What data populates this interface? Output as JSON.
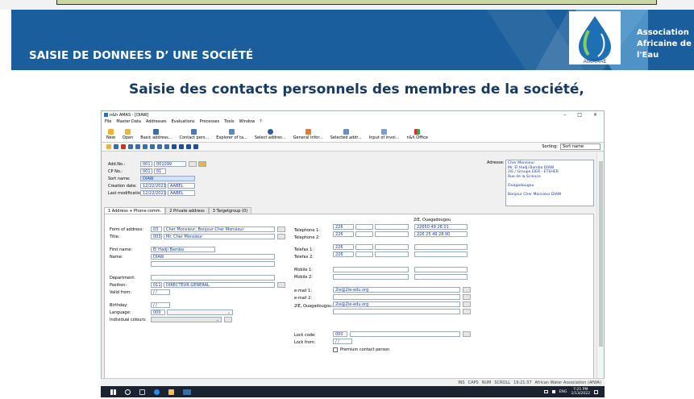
{
  "banner": {
    "title": "SAISIE DE DONNEES D’ UNE SOCIÉTÉ",
    "assoc_line1": "Association",
    "assoc_line2": "Africaine de l'Eau",
    "logo_text": "AIWA/AAE",
    "accent": "#1b5e9d"
  },
  "slide_heading": "Saisie des contacts personnels des membres de la société,",
  "app": {
    "window_title": "n&h AMAS - [DIAW]",
    "menu": [
      "File",
      "Master Data",
      "Addresses",
      "Evaluations",
      "Processes",
      "Tools",
      "Window",
      "?"
    ],
    "ribbon": [
      "New",
      "Open",
      "Basic address...",
      "Contact pers...",
      "Explorer of ta...",
      "Select addres...",
      "General infor...",
      "Selected addr...",
      "Input of invoi...",
      "n&h Office"
    ],
    "sorting_label": "Sorting:",
    "sorting_value": "Sort name"
  },
  "header_form": {
    "add_no_label": "Add.No.:",
    "add_no_1": "001",
    "add_no_2": "001099",
    "cp_no_label": "CP No.:",
    "cp_no_1": "001",
    "cp_no_2": "01",
    "sort_name_label": "Sort name:",
    "sort_name": "DIAW",
    "creation_label": "Creation date:",
    "creation_date": "12/22/2021",
    "creation_user": "AABEL",
    "lastmod_label": "Last modification:",
    "lastmod_date": "12/22/2021",
    "lastmod_user": "AABEL",
    "adresse_label": "Adresse:",
    "adresse_lines": [
      "Cher Monsieur",
      "Mr. El Hadji Bamba  DIAW",
      "2iE / Groupe EIER - ETSHER",
      "Rue de la Science",
      "",
      "Ouagadougou",
      "",
      "Bonjour Cher Monsieur  DIAW"
    ]
  },
  "tabs": [
    "1 Address + Phone comm.",
    "2 Private address",
    "3 Targetgroup (0)"
  ],
  "contact_form": {
    "form_of_address_label": "Form of address:",
    "form_of_address_code": "03",
    "form_of_address": "Cher Monsieur; Bonjour Cher Monsieur",
    "title_label": "Title:",
    "title_code": "003",
    "title": "Mr. Cher Monsieur",
    "first_name_label": "First name:",
    "first_name": "El Hadji Bamba",
    "name_label": "Name:",
    "name": "DIAW",
    "department_label": "Department:",
    "position_label": "Position:",
    "position_code": "011",
    "position": "DIRECTEUR GENERAL",
    "valid_from_label": "Valid from:",
    "valid_from": "/ /",
    "birthday_label": "Birthday:",
    "birthday": "/ /",
    "language_label": "Language:",
    "language": "000",
    "colours_label": "Individual colours:",
    "phone_header": "2iE, Ouagadougou",
    "telephone1_label": "Telephone 1:",
    "telephone1_code": "226",
    "telephone1": "22650 49 28 01",
    "telephone2_label": "Telephone 2:",
    "telephone2_code": "226",
    "telephone2": "226 25 49 28 00",
    "telefax1_label": "Telefax 1:",
    "telefax1_code": "226",
    "telefax2_label": "Telefax 2:",
    "telefax2_code": "226",
    "mobile1_label": "Mobile 1:",
    "mobile2_label": "Mobile 2:",
    "email1_label": "e-mail 1:",
    "email1": "2ie@2ie-edu.org",
    "email2_label": "e-mail 2:",
    "email3_label": "2IE, Ouagadougou:",
    "email3": "2ie@2ie-edu.org",
    "lock_code_label": "Lock code:",
    "lock_code": "000",
    "lock_from_label": "Lock from:",
    "lock_from": "/ /",
    "premium_label": "Premium contact person"
  },
  "statusbar": {
    "ins": "INS",
    "caps": "CAPS",
    "num": "NUM",
    "scroll": "SCROLL",
    "time": "19:21:37",
    "org": "African Water Association (AfWA)"
  },
  "taskbar": {
    "tray_lang": "ENG",
    "clock_time": "7:21 PM",
    "clock_date": "1/13/2022"
  }
}
